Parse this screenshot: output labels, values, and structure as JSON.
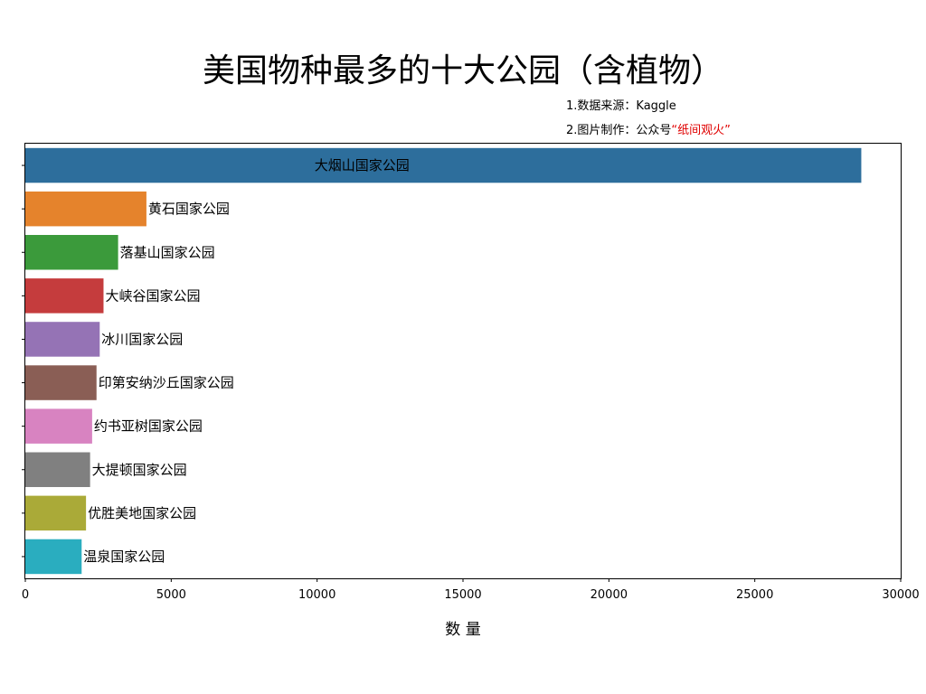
{
  "chart_data": {
    "type": "bar",
    "orientation": "horizontal",
    "title": "美国物种最多的十大公园（含植物）",
    "notes": {
      "line1": "1.数据来源：Kaggle",
      "line2_prefix": "2.图片制作：公众号",
      "line2_highlight": "“纸间观火”",
      "highlight_color": "#e00000"
    },
    "xlabel": "数 量",
    "xlim": [
      0,
      30000
    ],
    "xticks": [
      0,
      5000,
      10000,
      15000,
      20000,
      25000,
      30000
    ],
    "grid": false,
    "categories": [
      "大烟山国家公园",
      "黄石国家公园",
      "落基山国家公园",
      "大峡谷国家公园",
      "冰川国家公园",
      "印第安纳沙丘国家公园",
      "约书亚树国家公园",
      "大提顿国家公园",
      "优胜美地国家公园",
      "温泉国家公园"
    ],
    "values": [
      28650,
      4150,
      3180,
      2680,
      2550,
      2440,
      2290,
      2220,
      2080,
      1930
    ],
    "colors": [
      "#2d6e9c",
      "#e5832c",
      "#3b9a3b",
      "#c53c3d",
      "#9573b5",
      "#8a5e55",
      "#d883c1",
      "#808080",
      "#aaaa38",
      "#2aadbf"
    ],
    "label_colors": [
      "#ffffff",
      "#000000",
      "#000000",
      "#000000",
      "#000000",
      "#000000",
      "#000000",
      "#000000",
      "#000000",
      "#000000"
    ]
  }
}
